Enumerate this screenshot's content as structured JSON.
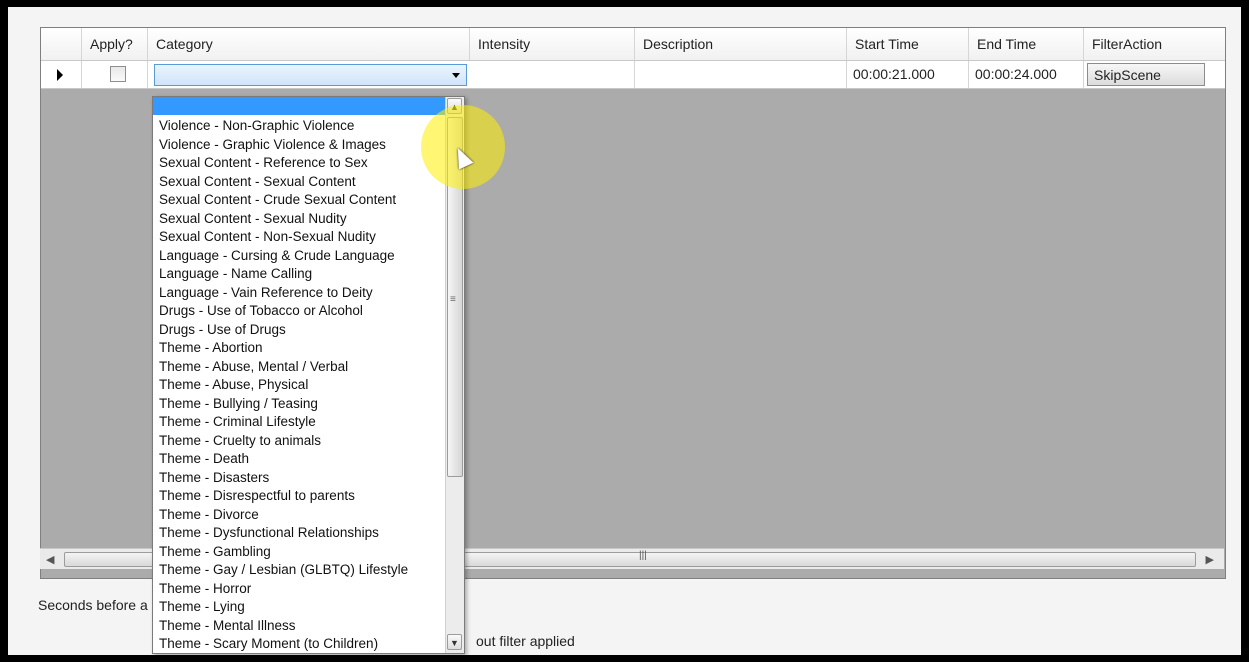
{
  "grid": {
    "headers": [
      "Apply?",
      "Category",
      "Intensity",
      "Description",
      "Start Time",
      "End Time",
      "FilterAction"
    ],
    "row": {
      "start_time": "00:00:21.000",
      "end_time": "00:00:24.000",
      "filter_action": "SkipScene"
    }
  },
  "dropdown": {
    "items": [
      "Violence - Non-Graphic Violence",
      "Violence - Graphic Violence & Images",
      "Sexual Content - Reference to Sex",
      "Sexual Content - Sexual Content",
      "Sexual Content - Crude Sexual Content",
      "Sexual Content - Sexual Nudity",
      "Sexual Content - Non-Sexual Nudity",
      "Language - Cursing & Crude Language",
      "Language - Name Calling",
      "Language - Vain Reference to Deity",
      "Drugs - Use of Tobacco or Alcohol",
      "Drugs - Use of Drugs",
      "Theme - Abortion",
      "Theme - Abuse, Mental / Verbal",
      "Theme - Abuse, Physical",
      "Theme - Bullying / Teasing",
      "Theme - Criminal Lifestyle",
      "Theme - Cruelty to animals",
      "Theme - Death",
      "Theme - Disasters",
      "Theme - Disrespectful to parents",
      "Theme - Divorce",
      "Theme - Dysfunctional Relationships",
      "Theme - Gambling",
      "Theme - Gay / Lesbian (GLBTQ) Lifestyle",
      "Theme - Horror",
      "Theme - Lying",
      "Theme - Mental Illness",
      "Theme - Scary Moment (to Children)"
    ]
  },
  "bottom": {
    "seconds_label": "Seconds before a",
    "filter_label": "out filter applied"
  }
}
